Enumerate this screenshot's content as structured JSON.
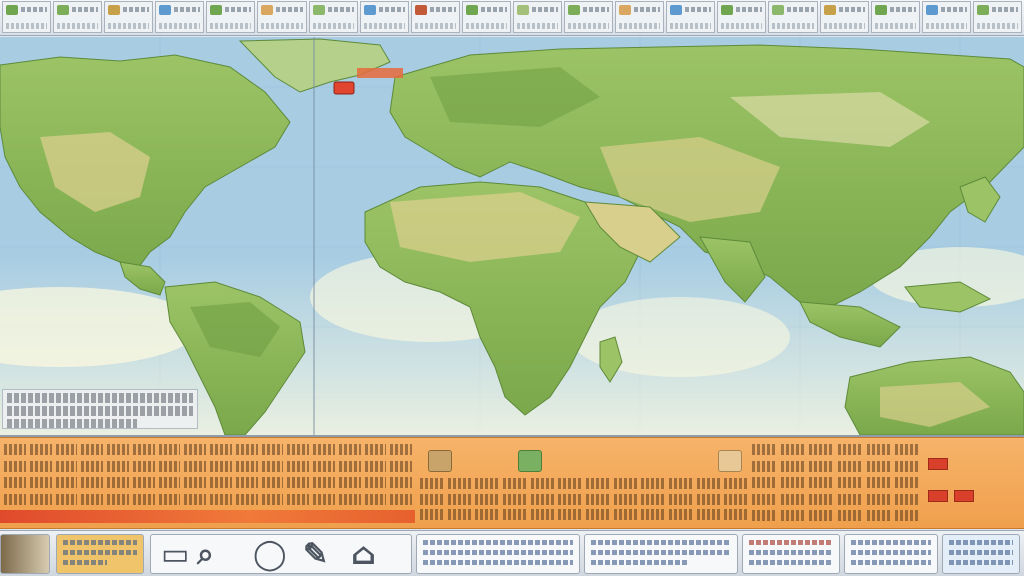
{
  "thumbnails": {
    "colors": [
      "#6fa64f",
      "#7cae59",
      "#c7a04a",
      "#5c9ad0",
      "#6fa64f",
      "#d9a760",
      "#8bb86a",
      "#5c9ad0",
      "#c25a3a",
      "#6fa64f",
      "#a3c07a",
      "#7cae59",
      "#d9a760",
      "#5c9ad0",
      "#6fa64f",
      "#8bb86a",
      "#c7a04a",
      "#6fa64f",
      "#5c9ad0",
      "#7cae59"
    ]
  },
  "colors": {
    "ocean": "#a8cde3",
    "land": "#8cbb5a",
    "land_dark": "#6f9e42",
    "desert": "#d9cf8c",
    "panel_orange": "#f4a65a",
    "panel_red": "#e04a2c",
    "toolbar": "#e3e8ed"
  },
  "icons": {
    "pin": "map-pin-icon",
    "search": "magnifier-icon",
    "globe": "globe-icon",
    "chart": "chart-icon",
    "menu": "menu-icon"
  }
}
